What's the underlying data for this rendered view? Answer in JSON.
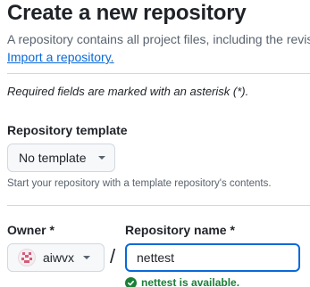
{
  "page": {
    "title": "Create a new repository",
    "intro": "A repository contains all project files, including the revisi",
    "import_link": "Import a repository",
    "import_tail": "."
  },
  "form": {
    "required_note": "Required fields are marked with an asterisk (*).",
    "template": {
      "label": "Repository template",
      "selected": "No template",
      "help": "Start your repository with a template repository's contents."
    },
    "owner": {
      "label": "Owner *",
      "selected": "aiwvx"
    },
    "separator": "/",
    "repo_name": {
      "label": "Repository name *",
      "value": "nettest"
    },
    "availability": "nettest is available."
  },
  "colors": {
    "link": "#0969da",
    "success": "#1a7f37",
    "focus_border": "#0969da"
  },
  "icons": {
    "owner_avatar": "identicon-avatar",
    "dropdown": "triangle-down-icon",
    "status": "check-circle-icon"
  }
}
